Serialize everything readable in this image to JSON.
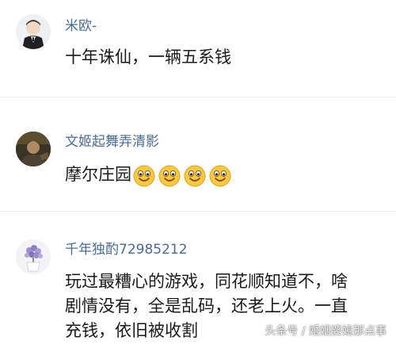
{
  "comments": [
    {
      "username": "米欧-",
      "text_lines": [
        "十年诛仙，一辆五系钱"
      ],
      "avatar": "child-in-suit-avatar"
    },
    {
      "username": "文姬起舞弄清影",
      "text": "摩尔庄园",
      "emoji_count": 4,
      "emoji": "smiling-face-icon",
      "avatar": "dark-portrait-avatar"
    },
    {
      "username": "千年独酌72985212",
      "text_lines": [
        "玩过最糟心的游戏，同花顺知道不，啥",
        "剧情没有，全是乱码，还老上火。一直",
        "充钱，依旧被收割"
      ],
      "avatar": "lavender-flowers-avatar"
    }
  ],
  "watermark": "头条号 / 婚姻婆媳那点事",
  "colors": {
    "username": "#4a6b94",
    "text": "#1a1a1a",
    "separator": "#ececec",
    "emoji_face": "#f7c842"
  }
}
